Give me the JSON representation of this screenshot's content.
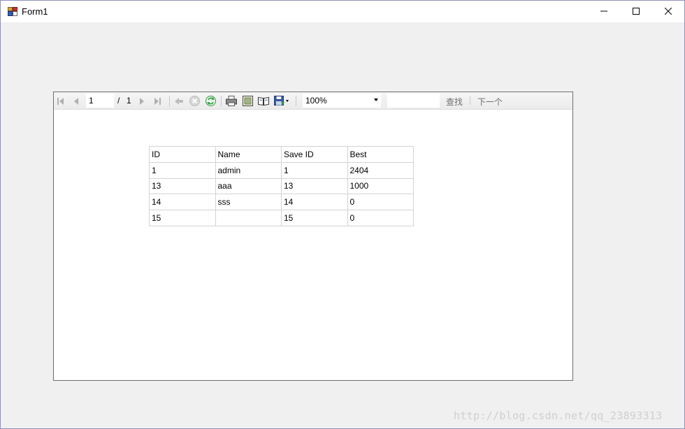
{
  "window": {
    "title": "Form1",
    "controls": {
      "minimize": "minimize",
      "maximize": "maximize",
      "close": "close"
    }
  },
  "toolbar": {
    "current_page": "1",
    "page_separator": "/",
    "total_pages": "1",
    "zoom": "100%",
    "find_text": "",
    "find_label": "查找",
    "next_label": "下一个",
    "icons": [
      "first-page-icon",
      "prev-page-icon",
      "next-page-icon",
      "last-page-icon",
      "back-icon",
      "stop-icon",
      "refresh-icon",
      "print-icon",
      "print-layout-icon",
      "page-setup-icon",
      "export-icon"
    ]
  },
  "report": {
    "columns": [
      "ID",
      "Name",
      "Save ID",
      "Best"
    ],
    "rows": [
      [
        "1",
        "admin",
        "1",
        "2404"
      ],
      [
        "13",
        "aaa",
        "13",
        "1000"
      ],
      [
        "14",
        "sss",
        "14",
        "0"
      ],
      [
        "15",
        "",
        "15",
        "0"
      ]
    ]
  },
  "watermark": "http://blog.csdn.net/qq_23893313",
  "colors": {
    "form_bg": "#f0f0f0",
    "window_border": "#8f8fbf",
    "grid_border": "#d3d3d3",
    "refresh_green": "#2f9a3c"
  }
}
